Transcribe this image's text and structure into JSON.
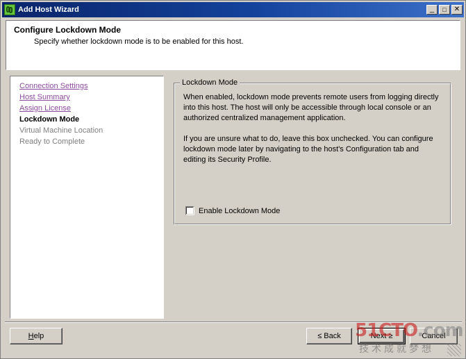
{
  "window": {
    "title": "Add Host Wizard",
    "icon": "vsphere-host-icon",
    "controls": {
      "minimize": "_",
      "maximize": "□",
      "close": "✕"
    }
  },
  "header": {
    "title": "Configure Lockdown Mode",
    "subtitle": "Specify whether lockdown mode is to be enabled for this host."
  },
  "sidebar": {
    "items": [
      {
        "label": "Connection Settings",
        "state": "completed"
      },
      {
        "label": "Host Summary",
        "state": "completed"
      },
      {
        "label": "Assign License",
        "state": "completed"
      },
      {
        "label": "Lockdown Mode",
        "state": "current"
      },
      {
        "label": "Virtual Machine Location",
        "state": "future"
      },
      {
        "label": "Ready to Complete",
        "state": "future"
      }
    ]
  },
  "main": {
    "groupbox": {
      "legend": "Lockdown Mode",
      "paragraphs": [
        "When enabled, lockdown mode prevents remote users from logging directly into this host. The host will only be accessible through local console or an authorized centralized management application.",
        "If you are unsure what to do, leave this box unchecked. You can configure lockdown mode later by navigating to the host's Configuration tab and editing its Security Profile."
      ],
      "checkbox": {
        "label": "Enable Lockdown Mode",
        "checked": false
      }
    }
  },
  "footer": {
    "help": "Help",
    "back": "≤ Back",
    "next": "Next ≥",
    "cancel": "Cancel"
  },
  "watermark": {
    "main": "51CTO",
    "domain": ".com",
    "tagline": "技术成就梦想"
  },
  "colors": {
    "titlebar_start": "#0a246a",
    "titlebar_end": "#3c70c8",
    "window_face": "#d4d0c8",
    "link": "#8e4ca0",
    "future_text": "#808080",
    "watermark_red": "#c81e1e"
  }
}
